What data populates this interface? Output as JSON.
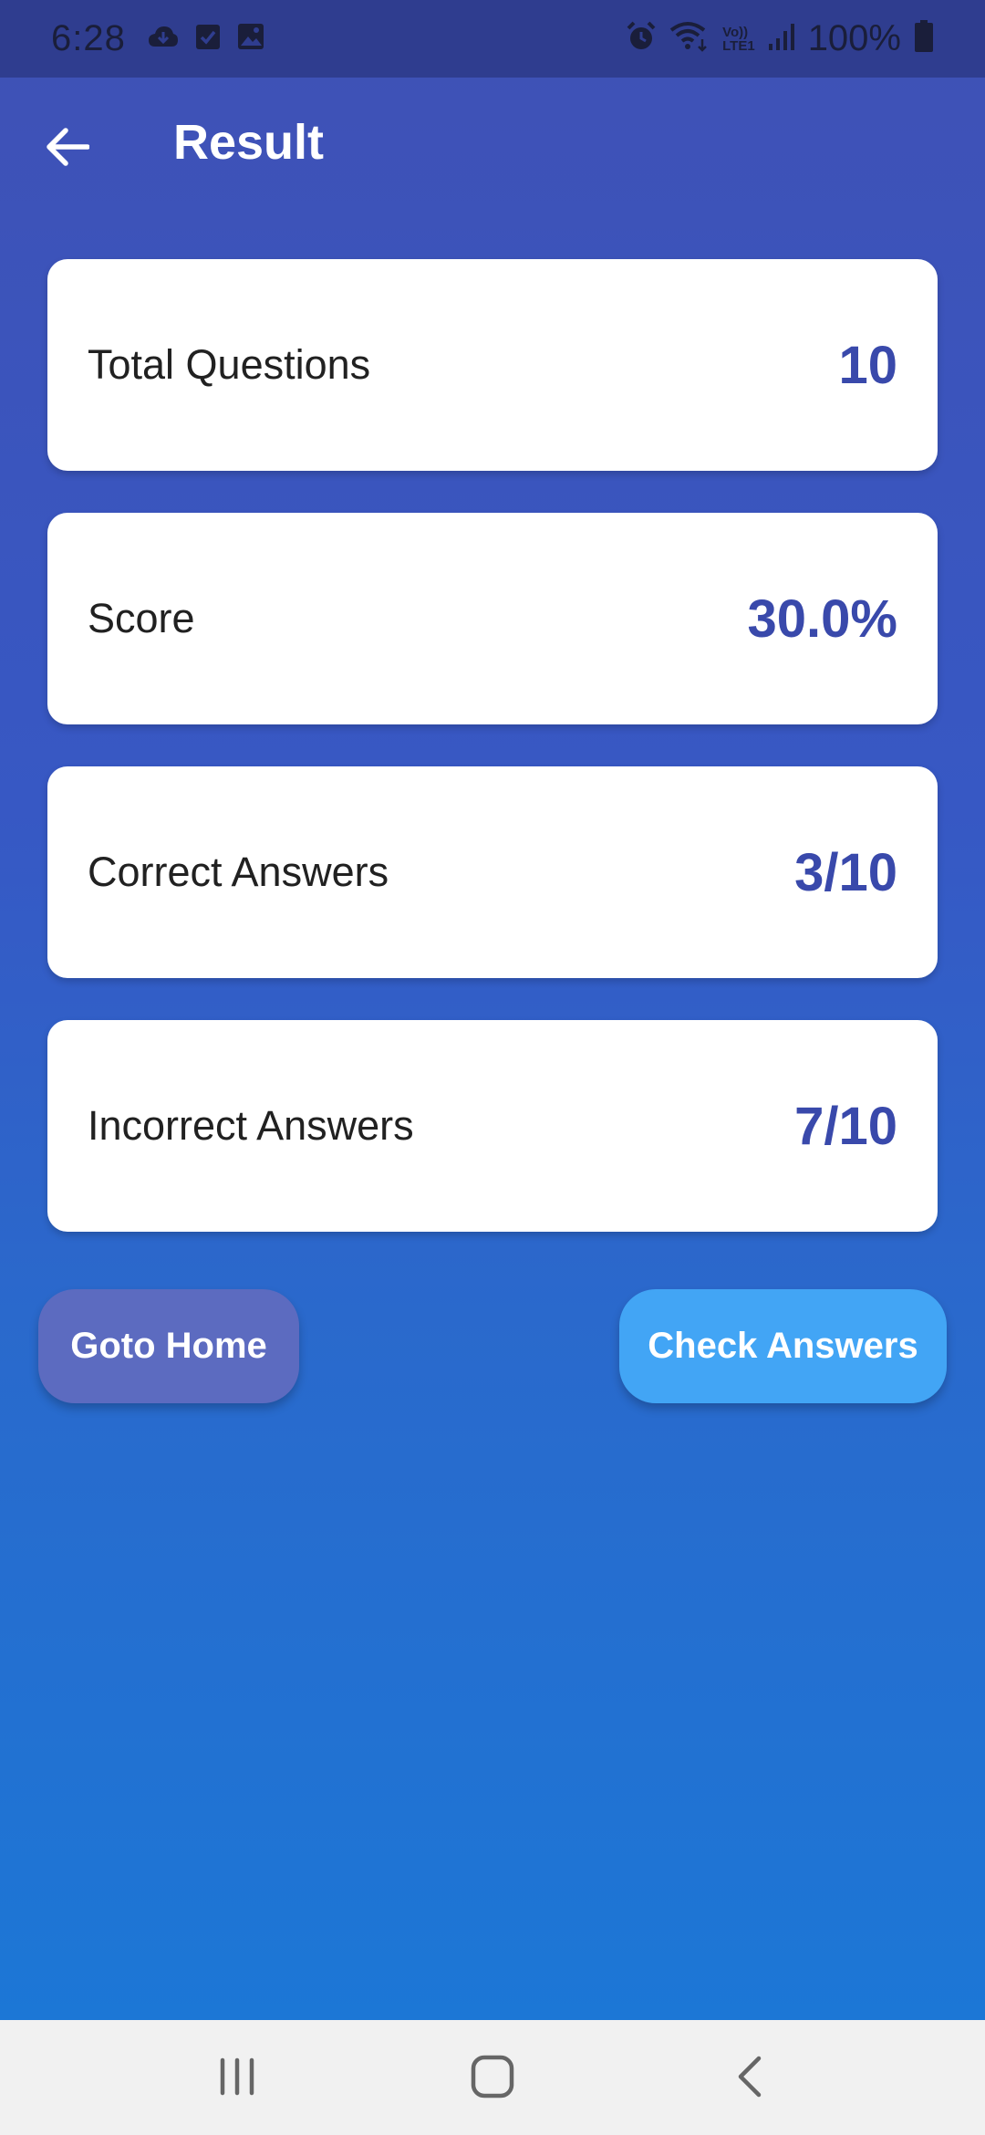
{
  "status_bar": {
    "time": "6:28",
    "battery": "100%",
    "icons_left": [
      "cloud-icon",
      "checkbox-icon",
      "image-icon"
    ],
    "icons_right": [
      "alarm-icon",
      "wifi-icon",
      "volte-icon",
      "signal-icon",
      "battery-icon"
    ],
    "volte_top": "Vo))",
    "volte_bottom": "LTE1"
  },
  "app_bar": {
    "title": "Result",
    "back_icon": "arrow-back-icon"
  },
  "cards": [
    {
      "label": "Total Questions",
      "value": "10"
    },
    {
      "label": "Score",
      "value": "30.0%"
    },
    {
      "label": "Correct Answers",
      "value": "3/10"
    },
    {
      "label": "Incorrect Answers",
      "value": "7/10"
    }
  ],
  "buttons": {
    "home_label": "Goto Home",
    "check_label": "Check Answers"
  },
  "colors": {
    "primary": "#3f51b5",
    "value_text": "#3949ab",
    "home_button": "#5c6bc0",
    "check_button": "#42a5f5"
  }
}
